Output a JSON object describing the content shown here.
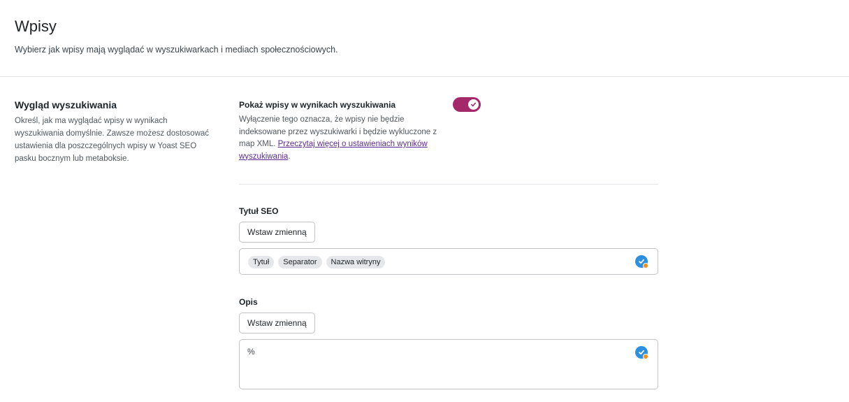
{
  "page": {
    "title": "Wpisy",
    "description": "Wybierz jak wpisy mają wyglądać w wyszukiwarkach i mediach społecznościowych."
  },
  "section": {
    "title": "Wygląd wyszukiwania",
    "description": "Określ, jak ma wyglądać wpisy w wynikach wyszukiwania domyślnie. Zawsze możesz dostosować ustawienia dla poszczególnych wpisy w Yoast SEO pasku bocznym lub metaboksie."
  },
  "toggle": {
    "label": "Pokaż wpisy w wynikach wyszukiwania",
    "checked": true,
    "color": "#a4286a",
    "description": "Wyłączenie tego oznacza, że wpisy nie będzie indeksowane przez wyszukiwarki i będzie wykluczone z map XML. ",
    "link_text": "Przeczytaj więcej o ustawieniach wyników wyszukiwania",
    "trailing": "."
  },
  "seo_title": {
    "label": "Tytuł SEO",
    "button": "Wstaw zmienną",
    "chips": [
      "Tytuł",
      "Separator",
      "Nazwa witryny"
    ],
    "icon": "ai-check-icon"
  },
  "meta_description": {
    "label": "Opis",
    "button": "Wstaw zmienną",
    "value": "%",
    "icon": "ai-check-icon"
  }
}
